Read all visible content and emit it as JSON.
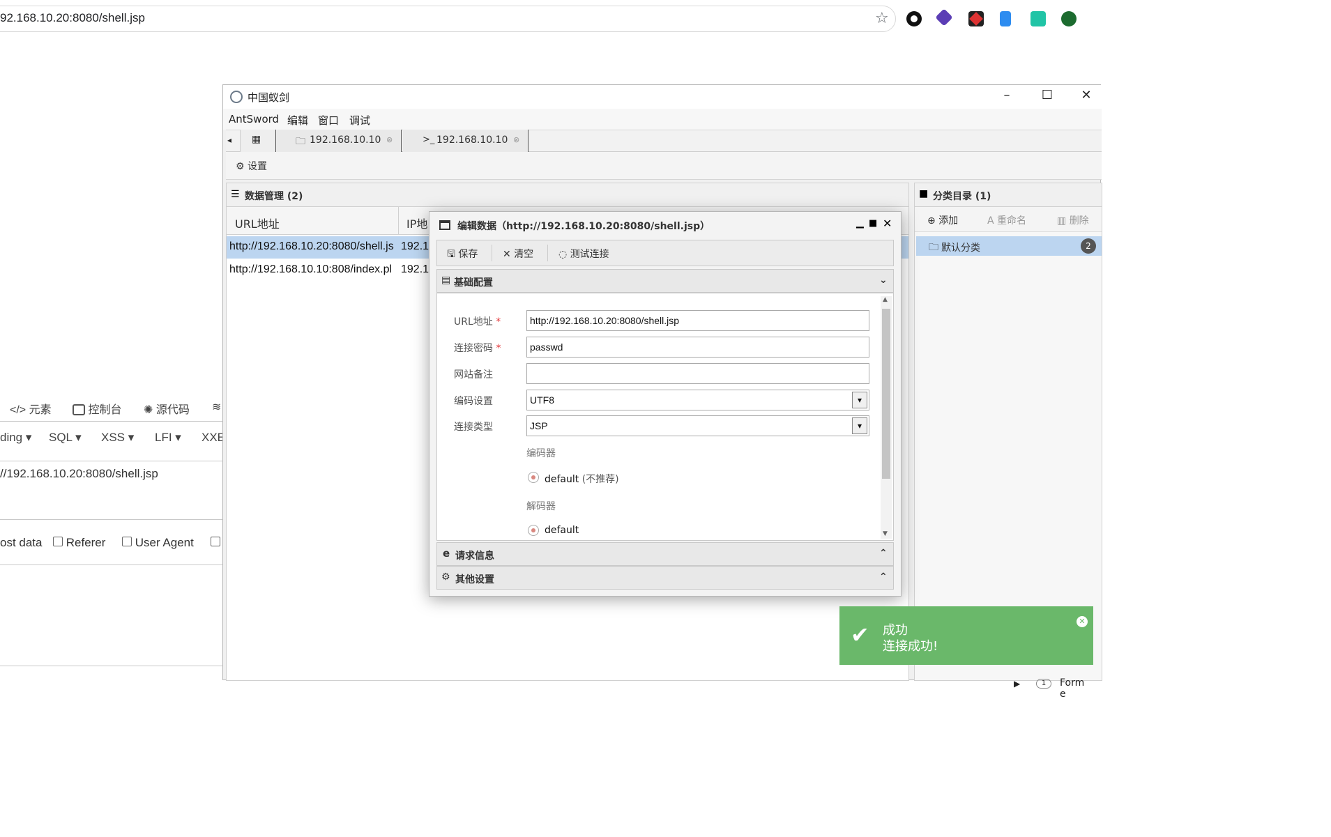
{
  "browser": {
    "address": "92.168.10.20:8080/shell.jsp"
  },
  "devtools": {
    "tabs": [
      {
        "icon": "code-icon",
        "label": "元素"
      },
      {
        "icon": "console-icon",
        "label": "控制台"
      },
      {
        "icon": "bug-icon",
        "label": "源代码"
      }
    ],
    "menus": [
      "ding",
      "SQL",
      "XSS",
      "LFI",
      "XXE"
    ],
    "url_value": "//192.168.10.20:8080/shell.jsp",
    "options": [
      "ost data",
      "Referer",
      "User Agent"
    ]
  },
  "window": {
    "title": "中国蚁剑",
    "menu": [
      "AntSword",
      "编辑",
      "窗口",
      "调试"
    ],
    "tabs": [
      {
        "icon": "folder-icon",
        "label": "192.168.10.10"
      },
      {
        "icon": "terminal-icon",
        "label": "192.168.10.10"
      }
    ],
    "settings_label": "设置"
  },
  "data_panel": {
    "title": "数据管理 (2)",
    "columns": [
      "URL地址",
      "IP地"
    ],
    "rows": [
      {
        "url": "http://192.168.10.20:8080/shell.js",
        "ip": "192.1"
      },
      {
        "url": "http://192.168.10.10:808/index.pl",
        "ip": "192.1"
      }
    ]
  },
  "category_panel": {
    "title": "分类目录 (1)",
    "add": "添加",
    "rename": "重命名",
    "delete": "删除",
    "item": "默认分类",
    "item_count": "2"
  },
  "dialog": {
    "title": "编辑数据（http://192.168.10.20:8080/shell.jsp）",
    "save": "保存",
    "clear": "清空",
    "test": "测试连接",
    "section_basic": "基础配置",
    "section_request": "请求信息",
    "section_other": "其他设置",
    "fields": {
      "url_label": "URL地址",
      "url_value": "http://192.168.10.20:8080/shell.jsp",
      "pass_label": "连接密码",
      "pass_value": "passwd",
      "note_label": "网站备注",
      "note_value": "",
      "encoding_label": "编码设置",
      "encoding_value": "UTF8",
      "type_label": "连接类型",
      "type_value": "JSP",
      "encoder_label": "编码器",
      "encoder_option": "default",
      "encoder_hint": "(不推荐)",
      "decoder_label": "解码器",
      "decoder_option": "default"
    }
  },
  "toast": {
    "title": "成功",
    "message": "连接成功!",
    "color": "#6ab86a"
  },
  "status_fragment": "Form e",
  "status_page": "1"
}
